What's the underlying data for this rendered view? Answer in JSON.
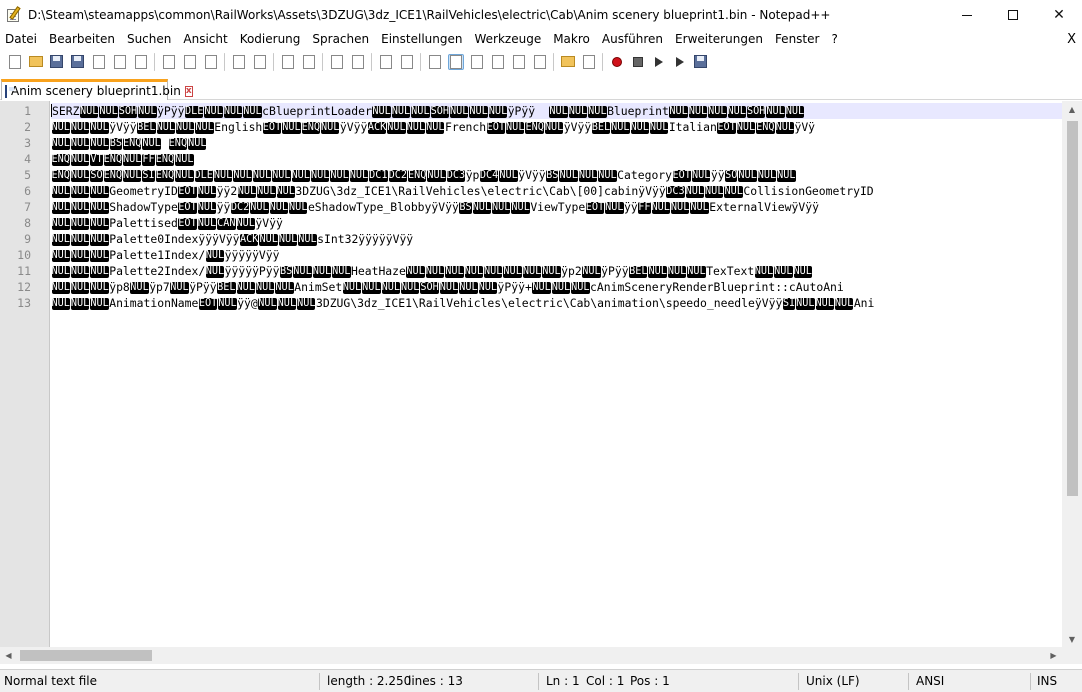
{
  "window": {
    "title": "D:\\Steam\\steamapps\\common\\RailWorks\\Assets\\3DZUG\\3dz_ICE1\\RailVehicles\\electric\\Cab\\Anim scenery blueprint1.bin - Notepad++",
    "minimize_label": "",
    "maximize_label": "",
    "close_label": "✕"
  },
  "menu": {
    "items": [
      "Datei",
      "Bearbeiten",
      "Suchen",
      "Ansicht",
      "Kodierung",
      "Sprachen",
      "Einstellungen",
      "Werkzeuge",
      "Makro",
      "Ausführen",
      "Erweiterungen",
      "Fenster",
      "?"
    ],
    "close_doc": "X"
  },
  "toolbar": {
    "icons": [
      "new-file-icon",
      "open-file-icon",
      "save-icon",
      "save-all-icon",
      "close-icon",
      "close-all-icon",
      "print-icon",
      "cut-icon",
      "copy-icon",
      "paste-icon",
      "undo-icon",
      "redo-icon",
      "find-icon",
      "replace-icon",
      "zoom-in-icon",
      "zoom-out-icon",
      "sync-vertical-icon",
      "sync-horizontal-icon",
      "word-wrap-icon",
      "show-all-chars-icon",
      "indent-guide-icon",
      "user-language-icon",
      "doc-map-icon",
      "function-list-icon",
      "folder-workspace-icon",
      "monitoring-icon",
      "record-macro-icon",
      "stop-macro-icon",
      "play-macro-icon",
      "run-macro-multiple-icon",
      "save-macro-icon"
    ]
  },
  "tab": {
    "label": "Anim scenery blueprint1.bin",
    "close_glyph": "x"
  },
  "editor": {
    "line_numbers": [
      "1",
      "2",
      "3",
      "4",
      "5",
      "6",
      "7",
      "8",
      "9",
      "10",
      "11",
      "12",
      "13"
    ],
    "lines": [
      [
        [
          "t",
          "SERZ"
        ],
        [
          "c",
          "NUL"
        ],
        [
          "c",
          "NUL"
        ],
        [
          "c",
          "SOH"
        ],
        [
          "c",
          "NUL"
        ],
        [
          "t",
          "ÿPÿÿ"
        ],
        [
          "c",
          "DLE"
        ],
        [
          "c",
          "NUL"
        ],
        [
          "c",
          "NUL"
        ],
        [
          "c",
          "NUL"
        ],
        [
          "t",
          "cBlueprintLoader"
        ],
        [
          "c",
          "NUL"
        ],
        [
          "c",
          "NUL"
        ],
        [
          "c",
          "NUL"
        ],
        [
          "c",
          "SOH"
        ],
        [
          "c",
          "NUL"
        ],
        [
          "c",
          "NUL"
        ],
        [
          "c",
          "NUL"
        ],
        [
          "t",
          "ÿPÿÿ  "
        ],
        [
          "c",
          "NUL"
        ],
        [
          "c",
          "NUL"
        ],
        [
          "c",
          "NUL"
        ],
        [
          "t",
          "Blueprint"
        ],
        [
          "c",
          "NUL"
        ],
        [
          "c",
          "NUL"
        ],
        [
          "c",
          "NUL"
        ],
        [
          "c",
          "NUL"
        ],
        [
          "c",
          "SOH"
        ],
        [
          "c",
          "NUL"
        ],
        [
          "c",
          "NUL"
        ]
      ],
      [
        [
          "c",
          "NUL"
        ],
        [
          "c",
          "NUL"
        ],
        [
          "c",
          "NUL"
        ],
        [
          "t",
          "ÿVÿÿ"
        ],
        [
          "c",
          "BEL"
        ],
        [
          "c",
          "NUL"
        ],
        [
          "c",
          "NUL"
        ],
        [
          "c",
          "NUL"
        ],
        [
          "t",
          "English"
        ],
        [
          "c",
          "EOT"
        ],
        [
          "c",
          "NUL"
        ],
        [
          "c",
          "ENQ"
        ],
        [
          "c",
          "NUL"
        ],
        [
          "t",
          "ÿVÿÿ"
        ],
        [
          "c",
          "ACK"
        ],
        [
          "c",
          "NUL"
        ],
        [
          "c",
          "NUL"
        ],
        [
          "c",
          "NUL"
        ],
        [
          "t",
          "French"
        ],
        [
          "c",
          "EOT"
        ],
        [
          "c",
          "NUL"
        ],
        [
          "c",
          "ENQ"
        ],
        [
          "c",
          "NUL"
        ],
        [
          "t",
          "ÿVÿÿ"
        ],
        [
          "c",
          "BEL"
        ],
        [
          "c",
          "NUL"
        ],
        [
          "c",
          "NUL"
        ],
        [
          "c",
          "NUL"
        ],
        [
          "t",
          "Italian"
        ],
        [
          "c",
          "EOT"
        ],
        [
          "c",
          "NUL"
        ],
        [
          "c",
          "ENQ"
        ],
        [
          "c",
          "NUL"
        ],
        [
          "t",
          "ÿVÿ"
        ]
      ],
      [
        [
          "c",
          "NUL"
        ],
        [
          "c",
          "NUL"
        ],
        [
          "c",
          "NUL"
        ],
        [
          "c",
          "BS"
        ],
        [
          "c",
          "ENQ"
        ],
        [
          "c",
          "NUL"
        ],
        [
          "t",
          " "
        ],
        [
          "c",
          "ENQ"
        ],
        [
          "c",
          "NUL"
        ]
      ],
      [
        [
          "c",
          "ENQ"
        ],
        [
          "c",
          "NUL"
        ],
        [
          "c",
          "VT"
        ],
        [
          "c",
          "ENQ"
        ],
        [
          "c",
          "NUL"
        ],
        [
          "c",
          "FF"
        ],
        [
          "c",
          "ENQ"
        ],
        [
          "c",
          "NUL"
        ]
      ],
      [
        [
          "c",
          "ENQ"
        ],
        [
          "c",
          "NUL"
        ],
        [
          "c",
          "SO"
        ],
        [
          "c",
          "ENQ"
        ],
        [
          "c",
          "NUL"
        ],
        [
          "c",
          "SI"
        ],
        [
          "c",
          "ENQ"
        ],
        [
          "c",
          "NUL"
        ],
        [
          "c",
          "DLE"
        ],
        [
          "c",
          "NUL"
        ],
        [
          "c",
          "NUL"
        ],
        [
          "c",
          "NUL"
        ],
        [
          "c",
          "NUL"
        ],
        [
          "c",
          "NUL"
        ],
        [
          "c",
          "NUL"
        ],
        [
          "c",
          "NUL"
        ],
        [
          "c",
          "NUL"
        ],
        [
          "c",
          "DC1"
        ],
        [
          "c",
          "DC2"
        ],
        [
          "c",
          "ENQ"
        ],
        [
          "c",
          "NUL"
        ],
        [
          "c",
          "DC3"
        ],
        [
          "t",
          "ÿp"
        ],
        [
          "c",
          "DC4"
        ],
        [
          "c",
          "NUL"
        ],
        [
          "t",
          "ÿVÿÿ"
        ],
        [
          "c",
          "BS"
        ],
        [
          "c",
          "NUL"
        ],
        [
          "c",
          "NUL"
        ],
        [
          "c",
          "NUL"
        ],
        [
          "t",
          "Category"
        ],
        [
          "c",
          "EOT"
        ],
        [
          "c",
          "NUL"
        ],
        [
          "t",
          "ÿÿ"
        ],
        [
          "c",
          "SO"
        ],
        [
          "c",
          "NUL"
        ],
        [
          "c",
          "NUL"
        ],
        [
          "c",
          "NUL"
        ]
      ],
      [
        [
          "c",
          "NUL"
        ],
        [
          "c",
          "NUL"
        ],
        [
          "c",
          "NUL"
        ],
        [
          "t",
          "GeometryID"
        ],
        [
          "c",
          "EOT"
        ],
        [
          "c",
          "NUL"
        ],
        [
          "t",
          "ÿÿ2"
        ],
        [
          "c",
          "NUL"
        ],
        [
          "c",
          "NUL"
        ],
        [
          "c",
          "NUL"
        ],
        [
          "t",
          "3DZUG\\3dz_ICE1\\RailVehicles\\electric\\Cab\\[00]cabinÿVÿÿ"
        ],
        [
          "c",
          "DC3"
        ],
        [
          "c",
          "NUL"
        ],
        [
          "c",
          "NUL"
        ],
        [
          "c",
          "NUL"
        ],
        [
          "t",
          "CollisionGeometryID"
        ]
      ],
      [
        [
          "c",
          "NUL"
        ],
        [
          "c",
          "NUL"
        ],
        [
          "c",
          "NUL"
        ],
        [
          "t",
          "ShadowType"
        ],
        [
          "c",
          "EOT"
        ],
        [
          "c",
          "NUL"
        ],
        [
          "t",
          "ÿÿ"
        ],
        [
          "c",
          "DC2"
        ],
        [
          "c",
          "NUL"
        ],
        [
          "c",
          "NUL"
        ],
        [
          "c",
          "NUL"
        ],
        [
          "t",
          "eShadowType_BlobbyÿVÿÿ"
        ],
        [
          "c",
          "BS"
        ],
        [
          "c",
          "NUL"
        ],
        [
          "c",
          "NUL"
        ],
        [
          "c",
          "NUL"
        ],
        [
          "t",
          "ViewType"
        ],
        [
          "c",
          "EOT"
        ],
        [
          "c",
          "NUL"
        ],
        [
          "t",
          "ÿÿ"
        ],
        [
          "c",
          "FF"
        ],
        [
          "c",
          "NUL"
        ],
        [
          "c",
          "NUL"
        ],
        [
          "c",
          "NUL"
        ],
        [
          "t",
          "ExternalViewÿVÿÿ"
        ]
      ],
      [
        [
          "c",
          "NUL"
        ],
        [
          "c",
          "NUL"
        ],
        [
          "c",
          "NUL"
        ],
        [
          "t",
          "Palettised"
        ],
        [
          "c",
          "EOT"
        ],
        [
          "c",
          "NUL"
        ],
        [
          "c",
          "CAN"
        ],
        [
          "c",
          "NUL"
        ],
        [
          "t",
          "ÿVÿÿ"
        ]
      ],
      [
        [
          "c",
          "NUL"
        ],
        [
          "c",
          "NUL"
        ],
        [
          "c",
          "NUL"
        ],
        [
          "t",
          "Palette0IndexÿÿÿVÿÿ"
        ],
        [
          "c",
          "ACK"
        ],
        [
          "c",
          "NUL"
        ],
        [
          "c",
          "NUL"
        ],
        [
          "c",
          "NUL"
        ],
        [
          "t",
          "sInt32ÿÿÿÿÿVÿÿ"
        ]
      ],
      [
        [
          "c",
          "NUL"
        ],
        [
          "c",
          "NUL"
        ],
        [
          "c",
          "NUL"
        ],
        [
          "t",
          "Palette1Index/"
        ],
        [
          "c",
          "NUL"
        ],
        [
          "t",
          "ÿÿÿÿÿVÿÿ"
        ]
      ],
      [
        [
          "c",
          "NUL"
        ],
        [
          "c",
          "NUL"
        ],
        [
          "c",
          "NUL"
        ],
        [
          "t",
          "Palette2Index/"
        ],
        [
          "c",
          "NUL"
        ],
        [
          "t",
          "ÿÿÿÿÿPÿÿ"
        ],
        [
          "c",
          "BS"
        ],
        [
          "c",
          "NUL"
        ],
        [
          "c",
          "NUL"
        ],
        [
          "c",
          "NUL"
        ],
        [
          "t",
          "HeatHaze"
        ],
        [
          "c",
          "NUL"
        ],
        [
          "c",
          "NUL"
        ],
        [
          "c",
          "NUL"
        ],
        [
          "c",
          "NUL"
        ],
        [
          "c",
          "NUL"
        ],
        [
          "c",
          "NUL"
        ],
        [
          "c",
          "NUL"
        ],
        [
          "c",
          "NUL"
        ],
        [
          "t",
          "ÿp2"
        ],
        [
          "c",
          "NUL"
        ],
        [
          "t",
          "ÿPÿÿ"
        ],
        [
          "c",
          "BEL"
        ],
        [
          "c",
          "NUL"
        ],
        [
          "c",
          "NUL"
        ],
        [
          "c",
          "NUL"
        ],
        [
          "t",
          "TexText"
        ],
        [
          "c",
          "NUL"
        ],
        [
          "c",
          "NUL"
        ],
        [
          "c",
          "NUL"
        ]
      ],
      [
        [
          "c",
          "NUL"
        ],
        [
          "c",
          "NUL"
        ],
        [
          "c",
          "NUL"
        ],
        [
          "t",
          "ÿp8"
        ],
        [
          "c",
          "NUL"
        ],
        [
          "t",
          "ÿp7"
        ],
        [
          "c",
          "NUL"
        ],
        [
          "t",
          "ÿPÿÿ"
        ],
        [
          "c",
          "BEL"
        ],
        [
          "c",
          "NUL"
        ],
        [
          "c",
          "NUL"
        ],
        [
          "c",
          "NUL"
        ],
        [
          "t",
          "AnimSet"
        ],
        [
          "c",
          "NUL"
        ],
        [
          "c",
          "NUL"
        ],
        [
          "c",
          "NUL"
        ],
        [
          "c",
          "NUL"
        ],
        [
          "c",
          "SOH"
        ],
        [
          "c",
          "NUL"
        ],
        [
          "c",
          "NUL"
        ],
        [
          "c",
          "NUL"
        ],
        [
          "t",
          "ÿPÿÿ+"
        ],
        [
          "c",
          "NUL"
        ],
        [
          "c",
          "NUL"
        ],
        [
          "c",
          "NUL"
        ],
        [
          "t",
          "cAnimSceneryRenderBlueprint::cAutoAni"
        ]
      ],
      [
        [
          "c",
          "NUL"
        ],
        [
          "c",
          "NUL"
        ],
        [
          "c",
          "NUL"
        ],
        [
          "t",
          "AnimationName"
        ],
        [
          "c",
          "EOT"
        ],
        [
          "c",
          "NUL"
        ],
        [
          "t",
          "ÿÿ@"
        ],
        [
          "c",
          "NUL"
        ],
        [
          "c",
          "NUL"
        ],
        [
          "c",
          "NUL"
        ],
        [
          "t",
          "3DZUG\\3dz_ICE1\\RailVehicles\\electric\\Cab\\animation\\speedo_needleÿVÿÿ"
        ],
        [
          "c",
          "SI"
        ],
        [
          "c",
          "NUL"
        ],
        [
          "c",
          "NUL"
        ],
        [
          "c",
          "NUL"
        ],
        [
          "t",
          "Ani"
        ]
      ]
    ]
  },
  "status": {
    "file_type": "Normal text file",
    "length": "length : 2.250",
    "lines": "lines : 13",
    "ln": "Ln : 1",
    "col": "Col : 1",
    "pos": "Pos : 1",
    "eol": "Unix (LF)",
    "encoding": "ANSI",
    "mode": "INS"
  }
}
